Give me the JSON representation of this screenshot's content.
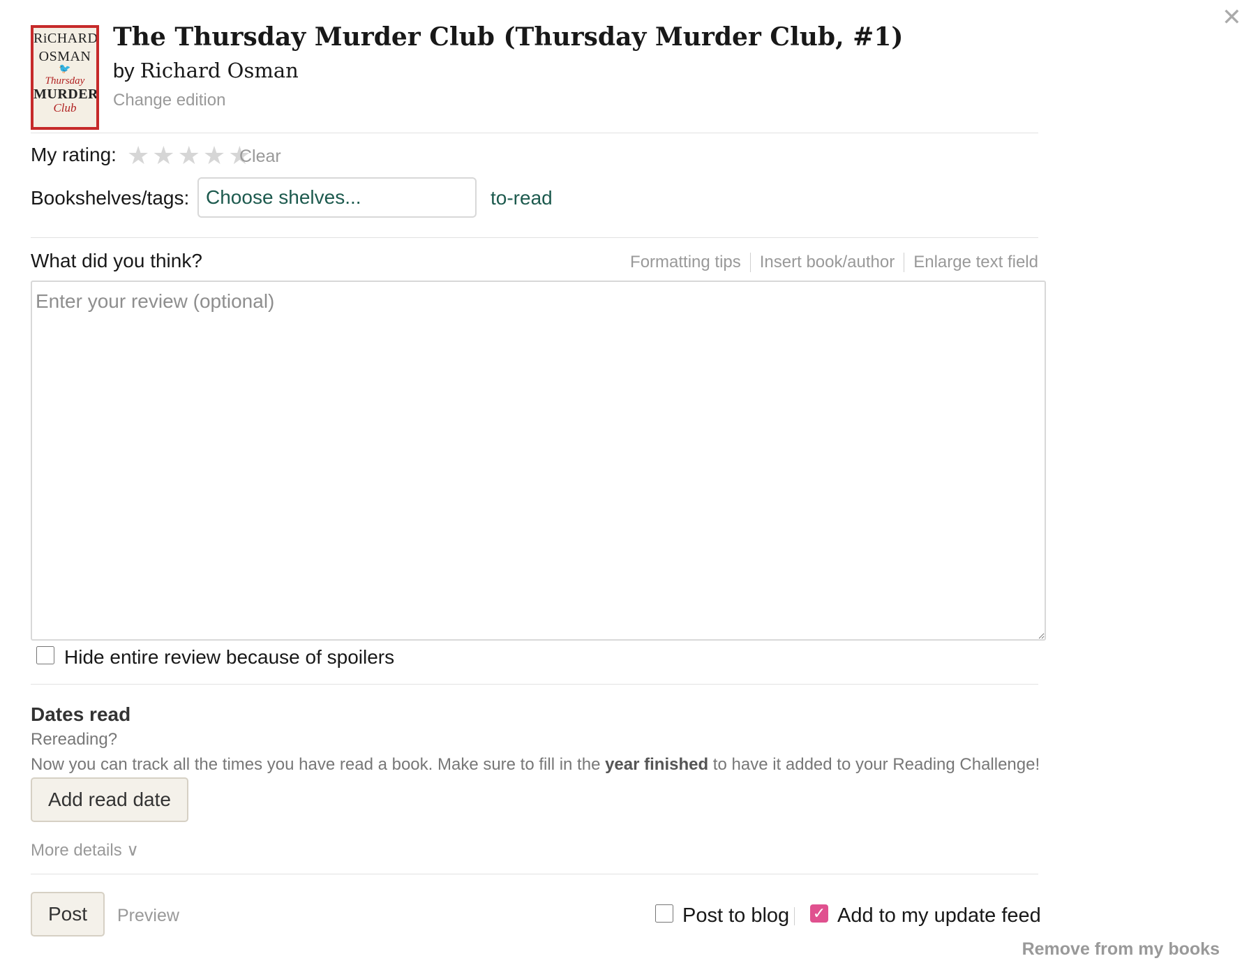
{
  "dialog": {
    "close_symbol": "✕"
  },
  "book": {
    "cover": {
      "author_line1": "RiCHARD",
      "author_line2": "OSMAN",
      "bird": "🐦",
      "title_small": "Thursday",
      "title_big": "MURDER",
      "title_club": "Club"
    },
    "title": "The Thursday Murder Club (Thursday Murder Club, #1)",
    "by": "by",
    "author": "Richard Osman",
    "change_edition": "Change edition"
  },
  "rating": {
    "label": "My rating:",
    "stars": [
      "★",
      "★",
      "★",
      "★",
      "★"
    ],
    "value": 0,
    "clear": "Clear"
  },
  "shelves": {
    "label": "Bookshelves/tags:",
    "placeholder": "Choose shelves...",
    "current": "to-read"
  },
  "review": {
    "label": "What did you think?",
    "tools": [
      "Formatting tips",
      "Insert book/author",
      "Enlarge text field"
    ],
    "placeholder": "Enter your review (optional)",
    "spoiler_label": "Hide entire review because of spoilers",
    "spoiler_checked": false
  },
  "dates": {
    "title": "Dates read",
    "rereading": "Rereading?",
    "note_before": "Now you can track all the times you have read a book. Make sure to fill in the ",
    "note_bold": "year finished",
    "note_after": " to have it added to your Reading Challenge!",
    "add_button": "Add read date",
    "more_details": "More details ∨"
  },
  "footer": {
    "post": "Post",
    "preview": "Preview",
    "post_to_blog": "Post to blog",
    "post_to_blog_checked": false,
    "update_feed": "Add to my update feed",
    "update_feed_checked": true,
    "checkmark": "✓",
    "remove": "Remove from my books"
  },
  "colors": {
    "link_green": "#1d5a4e",
    "feed_check_pink": "#e0518f",
    "button_bg": "#f4f1ea",
    "muted_gray": "#999999"
  }
}
